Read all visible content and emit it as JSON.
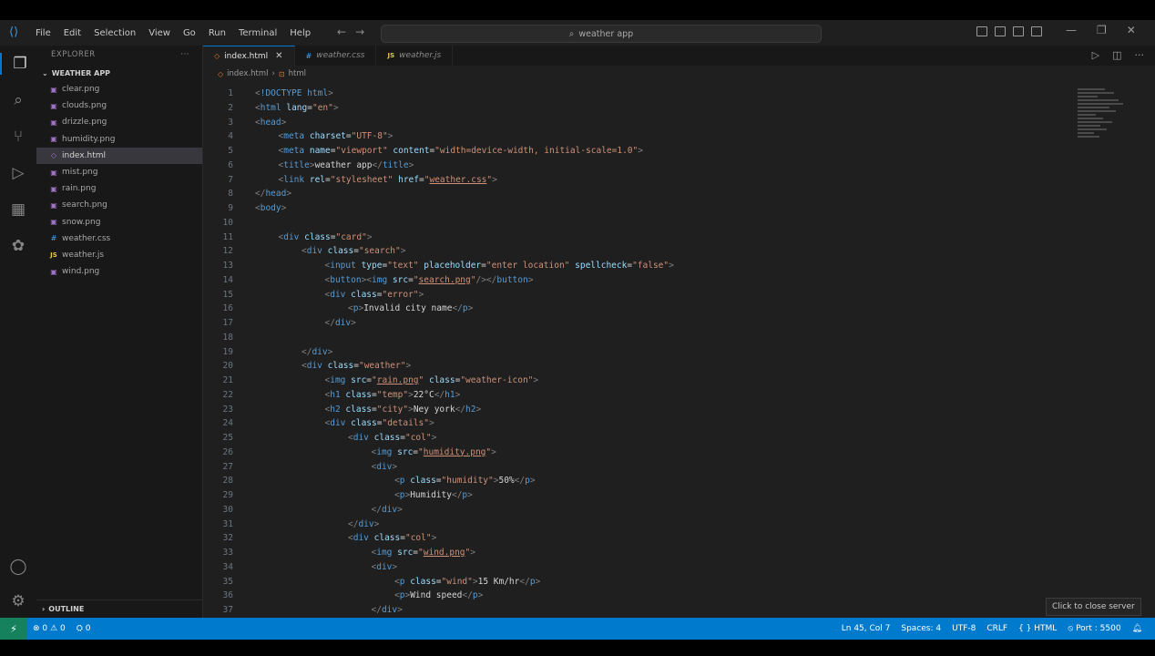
{
  "menu": [
    "File",
    "Edit",
    "Selection",
    "View",
    "Go",
    "Run",
    "Terminal",
    "Help"
  ],
  "search": {
    "text": "weather app"
  },
  "sidebar": {
    "title": "EXPLORER",
    "more": "···",
    "folder": "WEATHER APP",
    "files": [
      {
        "name": "clear.png",
        "type": "png"
      },
      {
        "name": "clouds.png",
        "type": "png"
      },
      {
        "name": "drizzle.png",
        "type": "png"
      },
      {
        "name": "humidity.png",
        "type": "png"
      },
      {
        "name": "index.html",
        "type": "html",
        "selected": true
      },
      {
        "name": "mist.png",
        "type": "png"
      },
      {
        "name": "rain.png",
        "type": "png"
      },
      {
        "name": "search.png",
        "type": "png"
      },
      {
        "name": "snow.png",
        "type": "png"
      },
      {
        "name": "weather.css",
        "type": "css"
      },
      {
        "name": "weather.js",
        "type": "js"
      },
      {
        "name": "wind.png",
        "type": "png"
      }
    ],
    "outline": "OUTLINE"
  },
  "tabs": [
    {
      "label": "index.html",
      "active": true
    },
    {
      "label": "weather.css"
    },
    {
      "label": "weather.js"
    }
  ],
  "breadcrumb": {
    "file": "index.html",
    "node": "html"
  },
  "tooltip": "Click to close server",
  "status": {
    "errors": "0",
    "warnings": "0",
    "ports": "0",
    "position": "Ln 45, Col 7",
    "spaces": "Spaces: 4",
    "encoding": "UTF-8",
    "eol": "CRLF",
    "language": "HTML",
    "port": "Port : 5500"
  },
  "code_lines": [
    {
      "n": "1",
      "segs": [
        [
          "p",
          "<"
        ],
        [
          "t",
          "!DOCTYPE html"
        ],
        [
          "p",
          ">"
        ]
      ],
      "indent": 0
    },
    {
      "n": "2",
      "segs": [
        [
          "p",
          "<"
        ],
        [
          "t",
          "html "
        ],
        [
          "a",
          "lang"
        ],
        [
          "x",
          "="
        ],
        [
          "s",
          "\"en\""
        ],
        [
          "p",
          ">"
        ]
      ],
      "indent": 0
    },
    {
      "n": "3",
      "segs": [
        [
          "p",
          "<"
        ],
        [
          "t",
          "head"
        ],
        [
          "p",
          ">"
        ]
      ],
      "indent": 0
    },
    {
      "n": "4",
      "segs": [
        [
          "p",
          "<"
        ],
        [
          "t",
          "meta "
        ],
        [
          "a",
          "charset"
        ],
        [
          "x",
          "="
        ],
        [
          "s",
          "\"UTF-8\""
        ],
        [
          "p",
          ">"
        ]
      ],
      "indent": 1
    },
    {
      "n": "5",
      "segs": [
        [
          "p",
          "<"
        ],
        [
          "t",
          "meta "
        ],
        [
          "a",
          "name"
        ],
        [
          "x",
          "="
        ],
        [
          "s",
          "\"viewport\" "
        ],
        [
          "a",
          "content"
        ],
        [
          "x",
          "="
        ],
        [
          "s",
          "\"width=device-width, initial-scale=1.0\""
        ],
        [
          "p",
          ">"
        ]
      ],
      "indent": 1
    },
    {
      "n": "6",
      "segs": [
        [
          "p",
          "<"
        ],
        [
          "t",
          "title"
        ],
        [
          "p",
          ">"
        ],
        [
          "x",
          "weather app"
        ],
        [
          "p",
          "</"
        ],
        [
          "t",
          "title"
        ],
        [
          "p",
          ">"
        ]
      ],
      "indent": 1
    },
    {
      "n": "7",
      "segs": [
        [
          "p",
          "<"
        ],
        [
          "t",
          "link "
        ],
        [
          "a",
          "rel"
        ],
        [
          "x",
          "="
        ],
        [
          "s",
          "\"stylesheet\" "
        ],
        [
          "a",
          "href"
        ],
        [
          "x",
          "="
        ],
        [
          "s",
          "\""
        ],
        [
          "su",
          "weather.css"
        ],
        [
          "s",
          "\""
        ],
        [
          "p",
          ">"
        ]
      ],
      "indent": 1
    },
    {
      "n": "8",
      "segs": [
        [
          "p",
          "</"
        ],
        [
          "t",
          "head"
        ],
        [
          "p",
          ">"
        ]
      ],
      "indent": 0
    },
    {
      "n": "9",
      "segs": [
        [
          "p",
          "<"
        ],
        [
          "t",
          "body"
        ],
        [
          "p",
          ">"
        ]
      ],
      "indent": 0
    },
    {
      "n": "10",
      "segs": [],
      "indent": 0
    },
    {
      "n": "11",
      "segs": [
        [
          "p",
          "<"
        ],
        [
          "t",
          "div "
        ],
        [
          "a",
          "class"
        ],
        [
          "x",
          "="
        ],
        [
          "s",
          "\"card\""
        ],
        [
          "p",
          ">"
        ]
      ],
      "indent": 1
    },
    {
      "n": "12",
      "segs": [
        [
          "p",
          "<"
        ],
        [
          "t",
          "div "
        ],
        [
          "a",
          "class"
        ],
        [
          "x",
          "="
        ],
        [
          "s",
          "\"search\""
        ],
        [
          "p",
          ">"
        ]
      ],
      "indent": 2
    },
    {
      "n": "13",
      "segs": [
        [
          "p",
          "<"
        ],
        [
          "t",
          "input "
        ],
        [
          "a",
          "type"
        ],
        [
          "x",
          "="
        ],
        [
          "s",
          "\"text\" "
        ],
        [
          "a",
          "placeholder"
        ],
        [
          "x",
          "="
        ],
        [
          "s",
          "\"enter location\" "
        ],
        [
          "a",
          "spellcheck"
        ],
        [
          "x",
          "="
        ],
        [
          "s",
          "\"false\""
        ],
        [
          "p",
          ">"
        ]
      ],
      "indent": 3
    },
    {
      "n": "14",
      "segs": [
        [
          "p",
          "<"
        ],
        [
          "t",
          "button"
        ],
        [
          "p",
          "><"
        ],
        [
          "t",
          "img "
        ],
        [
          "a",
          "src"
        ],
        [
          "x",
          "="
        ],
        [
          "s",
          "\""
        ],
        [
          "su",
          "search.png"
        ],
        [
          "s",
          "\""
        ],
        [
          "p",
          "/></"
        ],
        [
          "t",
          "button"
        ],
        [
          "p",
          ">"
        ]
      ],
      "indent": 3
    },
    {
      "n": "15",
      "segs": [
        [
          "p",
          "<"
        ],
        [
          "t",
          "div "
        ],
        [
          "a",
          "class"
        ],
        [
          "x",
          "="
        ],
        [
          "s",
          "\"error\""
        ],
        [
          "p",
          ">"
        ]
      ],
      "indent": 3
    },
    {
      "n": "16",
      "segs": [
        [
          "p",
          "<"
        ],
        [
          "t",
          "p"
        ],
        [
          "p",
          ">"
        ],
        [
          "x",
          "Invalid city name"
        ],
        [
          "p",
          "</"
        ],
        [
          "t",
          "p"
        ],
        [
          "p",
          ">"
        ]
      ],
      "indent": 4
    },
    {
      "n": "17",
      "segs": [
        [
          "p",
          "</"
        ],
        [
          "t",
          "div"
        ],
        [
          "p",
          ">"
        ]
      ],
      "indent": 3
    },
    {
      "n": "18",
      "segs": [],
      "indent": 0
    },
    {
      "n": "19",
      "segs": [
        [
          "p",
          "</"
        ],
        [
          "t",
          "div"
        ],
        [
          "p",
          ">"
        ]
      ],
      "indent": 2
    },
    {
      "n": "20",
      "segs": [
        [
          "p",
          "<"
        ],
        [
          "t",
          "div "
        ],
        [
          "a",
          "class"
        ],
        [
          "x",
          "="
        ],
        [
          "s",
          "\"weather\""
        ],
        [
          "p",
          ">"
        ]
      ],
      "indent": 2
    },
    {
      "n": "21",
      "segs": [
        [
          "p",
          "<"
        ],
        [
          "t",
          "img "
        ],
        [
          "a",
          "src"
        ],
        [
          "x",
          "="
        ],
        [
          "s",
          "\""
        ],
        [
          "su",
          "rain.png"
        ],
        [
          "s",
          "\" "
        ],
        [
          "a",
          "class"
        ],
        [
          "x",
          "="
        ],
        [
          "s",
          "\"weather-icon\""
        ],
        [
          "p",
          ">"
        ]
      ],
      "indent": 3
    },
    {
      "n": "22",
      "segs": [
        [
          "p",
          "<"
        ],
        [
          "t",
          "h1 "
        ],
        [
          "a",
          "class"
        ],
        [
          "x",
          "="
        ],
        [
          "s",
          "\"temp\""
        ],
        [
          "p",
          ">"
        ],
        [
          "x",
          "22°C"
        ],
        [
          "p",
          "</"
        ],
        [
          "t",
          "h1"
        ],
        [
          "p",
          ">"
        ]
      ],
      "indent": 3
    },
    {
      "n": "23",
      "segs": [
        [
          "p",
          "<"
        ],
        [
          "t",
          "h2 "
        ],
        [
          "a",
          "class"
        ],
        [
          "x",
          "="
        ],
        [
          "s",
          "\"city\""
        ],
        [
          "p",
          ">"
        ],
        [
          "x",
          "Ney york"
        ],
        [
          "p",
          "</"
        ],
        [
          "t",
          "h2"
        ],
        [
          "p",
          ">"
        ]
      ],
      "indent": 3
    },
    {
      "n": "24",
      "segs": [
        [
          "p",
          "<"
        ],
        [
          "t",
          "div "
        ],
        [
          "a",
          "class"
        ],
        [
          "x",
          "="
        ],
        [
          "s",
          "\"details\""
        ],
        [
          "p",
          ">"
        ]
      ],
      "indent": 3
    },
    {
      "n": "25",
      "segs": [
        [
          "p",
          "<"
        ],
        [
          "t",
          "div "
        ],
        [
          "a",
          "class"
        ],
        [
          "x",
          "="
        ],
        [
          "s",
          "\"col\""
        ],
        [
          "p",
          ">"
        ]
      ],
      "indent": 4
    },
    {
      "n": "26",
      "segs": [
        [
          "p",
          "<"
        ],
        [
          "t",
          "img "
        ],
        [
          "a",
          "src"
        ],
        [
          "x",
          "="
        ],
        [
          "s",
          "\""
        ],
        [
          "su",
          "humidity.png"
        ],
        [
          "s",
          "\""
        ],
        [
          "p",
          ">"
        ]
      ],
      "indent": 5
    },
    {
      "n": "27",
      "segs": [
        [
          "p",
          "<"
        ],
        [
          "t",
          "div"
        ],
        [
          "p",
          ">"
        ]
      ],
      "indent": 5
    },
    {
      "n": "28",
      "segs": [
        [
          "p",
          "<"
        ],
        [
          "t",
          "p "
        ],
        [
          "a",
          "class"
        ],
        [
          "x",
          "="
        ],
        [
          "s",
          "\"humidity\""
        ],
        [
          "p",
          ">"
        ],
        [
          "x",
          "50%"
        ],
        [
          "p",
          "</"
        ],
        [
          "t",
          "p"
        ],
        [
          "p",
          ">"
        ]
      ],
      "indent": 6
    },
    {
      "n": "29",
      "segs": [
        [
          "p",
          "<"
        ],
        [
          "t",
          "p"
        ],
        [
          "p",
          ">"
        ],
        [
          "x",
          "Humidity"
        ],
        [
          "p",
          "</"
        ],
        [
          "t",
          "p"
        ],
        [
          "p",
          ">"
        ]
      ],
      "indent": 6
    },
    {
      "n": "30",
      "segs": [
        [
          "p",
          "</"
        ],
        [
          "t",
          "div"
        ],
        [
          "p",
          ">"
        ]
      ],
      "indent": 5
    },
    {
      "n": "31",
      "segs": [
        [
          "p",
          "</"
        ],
        [
          "t",
          "div"
        ],
        [
          "p",
          ">"
        ]
      ],
      "indent": 4
    },
    {
      "n": "32",
      "segs": [
        [
          "p",
          "<"
        ],
        [
          "t",
          "div "
        ],
        [
          "a",
          "class"
        ],
        [
          "x",
          "="
        ],
        [
          "s",
          "\"col\""
        ],
        [
          "p",
          ">"
        ]
      ],
      "indent": 4
    },
    {
      "n": "33",
      "segs": [
        [
          "p",
          "<"
        ],
        [
          "t",
          "img "
        ],
        [
          "a",
          "src"
        ],
        [
          "x",
          "="
        ],
        [
          "s",
          "\""
        ],
        [
          "su",
          "wind.png"
        ],
        [
          "s",
          "\""
        ],
        [
          "p",
          ">"
        ]
      ],
      "indent": 5
    },
    {
      "n": "34",
      "segs": [
        [
          "p",
          "<"
        ],
        [
          "t",
          "div"
        ],
        [
          "p",
          ">"
        ]
      ],
      "indent": 5
    },
    {
      "n": "35",
      "segs": [
        [
          "p",
          "<"
        ],
        [
          "t",
          "p "
        ],
        [
          "a",
          "class"
        ],
        [
          "x",
          "="
        ],
        [
          "s",
          "\"wind\""
        ],
        [
          "p",
          ">"
        ],
        [
          "x",
          "15 Km/hr"
        ],
        [
          "p",
          "</"
        ],
        [
          "t",
          "p"
        ],
        [
          "p",
          ">"
        ]
      ],
      "indent": 6
    },
    {
      "n": "36",
      "segs": [
        [
          "p",
          "<"
        ],
        [
          "t",
          "p"
        ],
        [
          "p",
          ">"
        ],
        [
          "x",
          "Wind speed"
        ],
        [
          "p",
          "</"
        ],
        [
          "t",
          "p"
        ],
        [
          "p",
          ">"
        ]
      ],
      "indent": 6
    },
    {
      "n": "37",
      "segs": [
        [
          "p",
          "</"
        ],
        [
          "t",
          "div"
        ],
        [
          "p",
          ">"
        ]
      ],
      "indent": 5
    }
  ]
}
